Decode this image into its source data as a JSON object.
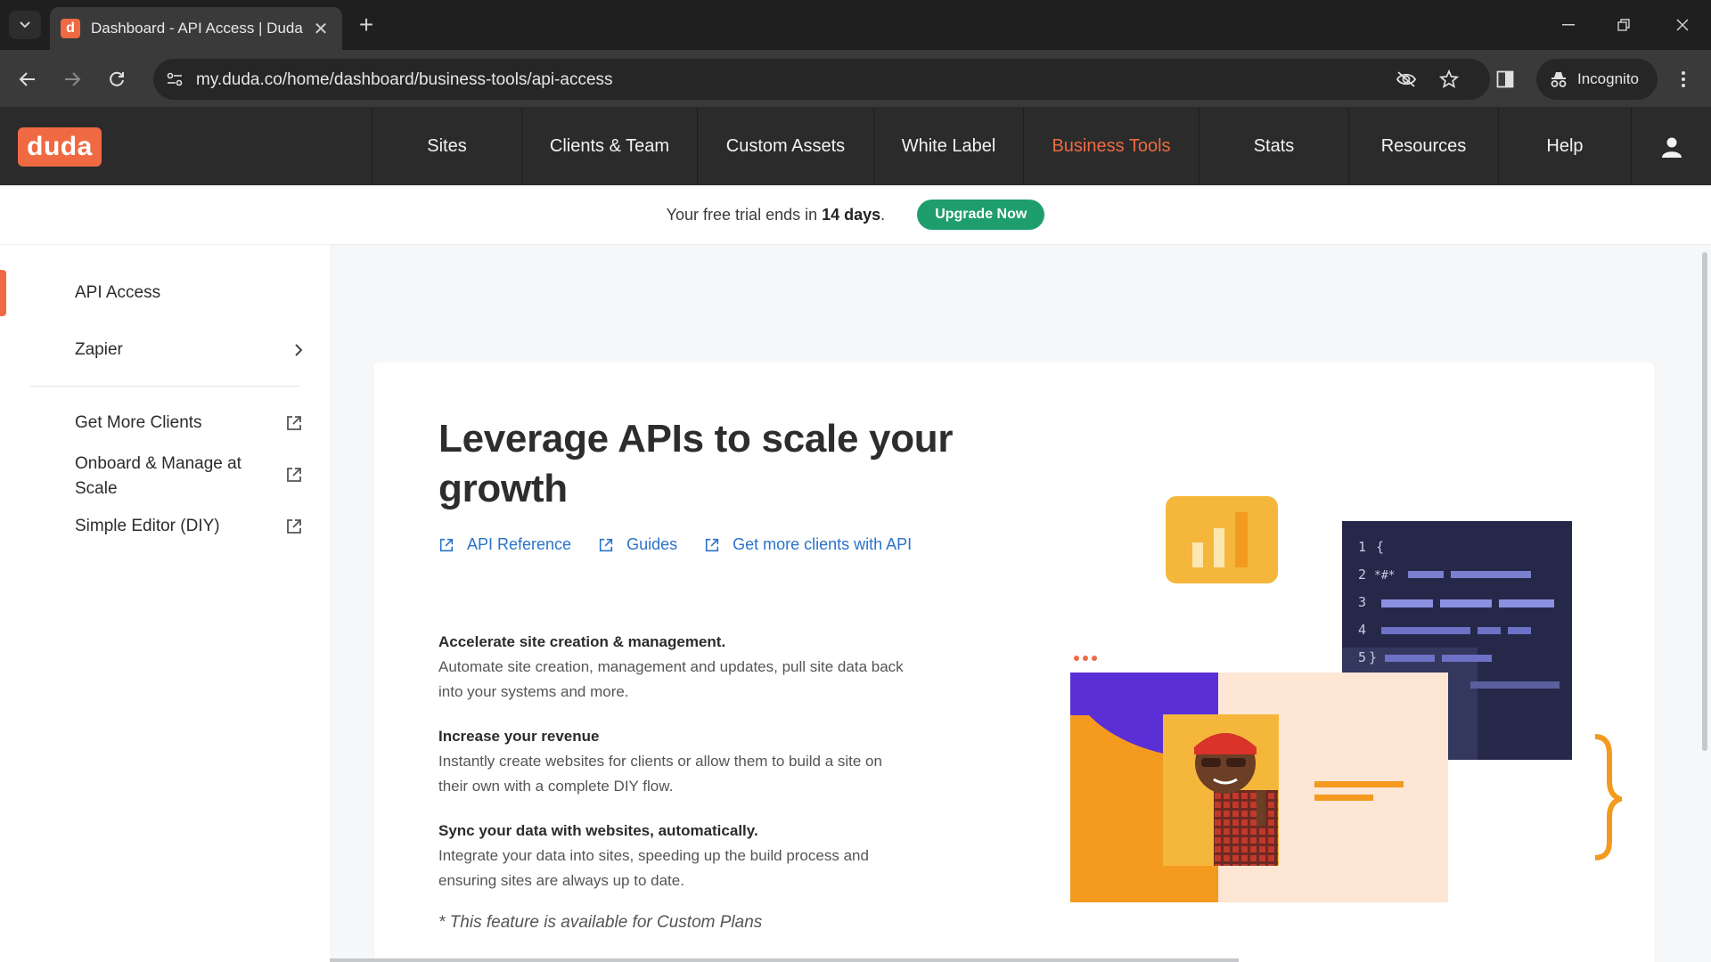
{
  "browser": {
    "tab_title": "Dashboard - API Access | Duda",
    "favicon_letter": "d",
    "url": "my.duda.co/home/dashboard/business-tools/api-access",
    "incognito_label": "Incognito"
  },
  "header": {
    "logo_text": "duda",
    "nav": [
      {
        "label": "Sites",
        "active": false
      },
      {
        "label": "Clients & Team",
        "active": false
      },
      {
        "label": "Custom Assets",
        "active": false
      },
      {
        "label": "White Label",
        "active": false
      },
      {
        "label": "Business Tools",
        "active": true
      },
      {
        "label": "Stats",
        "active": false
      },
      {
        "label": "Resources",
        "active": false
      },
      {
        "label": "Help",
        "active": false
      }
    ]
  },
  "trial": {
    "text_before": "Your free trial ends in ",
    "days": "14 days",
    "text_after": ".",
    "button": "Upgrade Now"
  },
  "sidebar": {
    "items": [
      {
        "label": "API Access",
        "active": true
      },
      {
        "label": "Zapier"
      }
    ],
    "external_items": [
      {
        "label": "Get More Clients"
      },
      {
        "label": "Onboard & Manage at Scale"
      },
      {
        "label": "Simple Editor (DIY)"
      }
    ]
  },
  "main": {
    "title": "Leverage APIs to scale your growth",
    "links": [
      {
        "label": "API Reference"
      },
      {
        "label": "Guides"
      },
      {
        "label": "Get more clients with API"
      }
    ],
    "features": [
      {
        "title": "Accelerate site creation & management.",
        "desc": "Automate site creation, management and updates, pull site data back into your systems and more."
      },
      {
        "title": "Increase your revenue",
        "desc": "Instantly create websites for clients or allow them to build a site on their own with a complete DIY flow."
      },
      {
        "title": "Sync your data with websites, automatically.",
        "desc": "Integrate your data into sites, speeding up the build process and ensuring sites are always up to date."
      }
    ],
    "footnote": "* This feature is available for Custom Plans",
    "code_lines": [
      "1",
      "2",
      "3",
      "4",
      "5"
    ],
    "code_glyphs": [
      "{",
      "*#*",
      "}"
    ]
  },
  "colors": {
    "brand": "#ef6a43",
    "active_nav": "#ef6a43",
    "upgrade": "#1f9e6d",
    "link": "#2a73c8"
  }
}
